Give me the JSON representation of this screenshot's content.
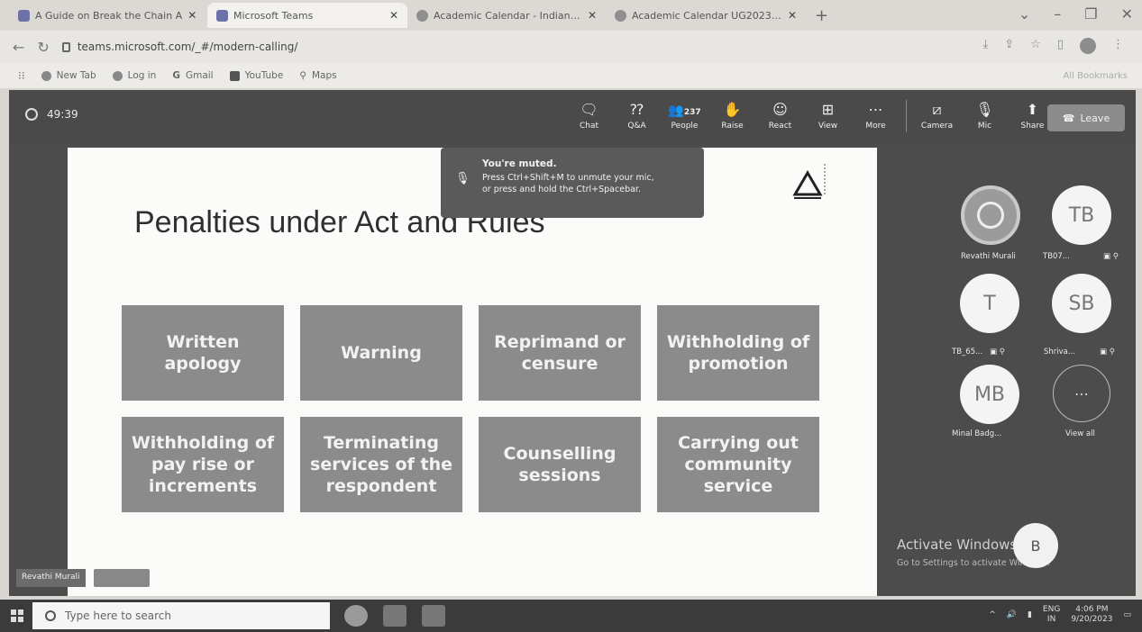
{
  "browser": {
    "tabs": [
      {
        "label": "A Guide on Break the Chain A",
        "active": false
      },
      {
        "label": "Microsoft Teams",
        "active": true
      },
      {
        "label": "Academic Calendar - Indian Inst",
        "active": false
      },
      {
        "label": "Academic Calendar UG2023-24",
        "active": false
      }
    ],
    "url": "teams.microsoft.com/_#/modern-calling/",
    "bookmarks": [
      "New Tab",
      "Log in",
      "Gmail",
      "YouTube",
      "Maps"
    ],
    "all_bookmarks": "All Bookmarks"
  },
  "meeting": {
    "timer": "49:39",
    "controls": {
      "chat": "Chat",
      "qa": "Q&A",
      "people": "People",
      "people_count": "237",
      "raise": "Raise",
      "react": "React",
      "view": "View",
      "more": "More",
      "camera": "Camera",
      "mic": "Mic",
      "share": "Share",
      "leave": "Leave"
    },
    "toast": {
      "title": "You're muted.",
      "line1": "Press Ctrl+Shift+M to unmute your mic,",
      "line2": "or press and hold the Ctrl+Spacebar."
    }
  },
  "slide": {
    "title": "Penalties under Act and Rules",
    "cells": [
      "Written apology",
      "Warning",
      "Reprimand or censure",
      "Withholding of promotion",
      "Withholding of pay rise or increments",
      "Terminating services of the respondent",
      "Counselling sessions",
      "Carrying out community service"
    ]
  },
  "participants": [
    {
      "initials": "",
      "name": "Revathi Murali"
    },
    {
      "initials": "TB",
      "name": "TB07..."
    },
    {
      "initials": "T",
      "name": "TB_65..."
    },
    {
      "initials": "SB",
      "name": "Shriva..."
    },
    {
      "initials": "MB",
      "name": "Minal Badg..."
    },
    {
      "initials": "",
      "name": "View all"
    }
  ],
  "self_view_name": "Revathi Murali",
  "watermark": {
    "title": "Activate Windows",
    "subtitle": "Go to Settings to activate Windows."
  },
  "speaker_initial": "B",
  "taskbar": {
    "search_placeholder": "Type here to search",
    "lang": "ENG",
    "region": "IN",
    "time": "4:06 PM",
    "date": "9/20/2023"
  }
}
